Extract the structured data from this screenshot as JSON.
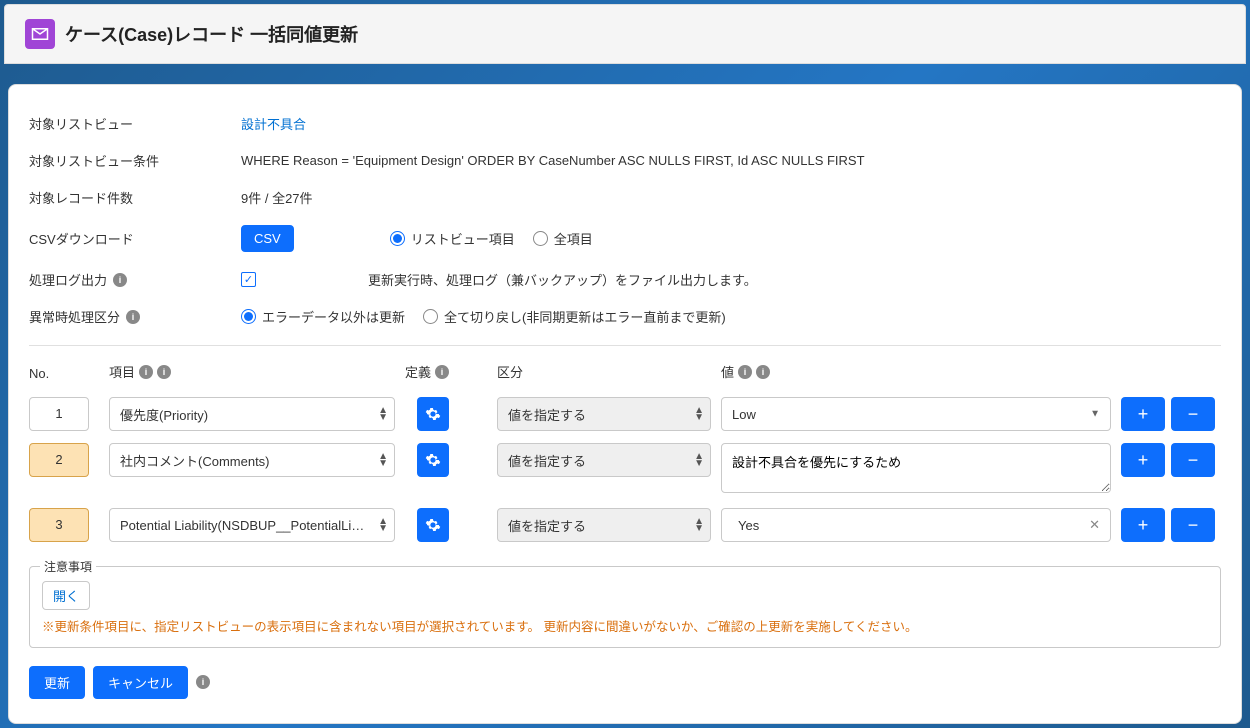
{
  "header": {
    "title": "ケース(Case)レコード 一括同値更新"
  },
  "info": {
    "listview_label": "対象リストビュー",
    "listview_value": "設計不具合",
    "condition_label": "対象リストビュー条件",
    "condition_value": "WHERE  Reason = 'Equipment Design'  ORDER BY  CaseNumber ASC NULLS FIRST, Id ASC NULLS FIRST",
    "count_label": "対象レコード件数",
    "count_value": "9件 / 全27件",
    "csv_label": "CSVダウンロード",
    "csv_button": "CSV",
    "csv_radio_a": "リストビュー項目",
    "csv_radio_b": "全項目",
    "log_label": "処理ログ出力",
    "log_desc": "更新実行時、処理ログ（兼バックアップ）をファイル出力します。",
    "err_label": "異常時処理区分",
    "err_radio_a": "エラーデータ以外は更新",
    "err_radio_b": "全て切り戻し(非同期更新はエラー直前まで更新)"
  },
  "grid": {
    "hdr_no": "No.",
    "hdr_field": "項目",
    "hdr_def": "定義",
    "hdr_type": "区分",
    "hdr_value": "値",
    "type_select_label": "値を指定する",
    "rows": [
      {
        "no": "1",
        "hl": false,
        "field": "優先度(Priority)",
        "value": "Low",
        "valuetype": "dd"
      },
      {
        "no": "2",
        "hl": true,
        "field": "社内コメント(Comments)",
        "value": "設計不具合を優先にするため",
        "valuetype": "ta"
      },
      {
        "no": "3",
        "hl": true,
        "field": "Potential Liability(NSDBUP__PotentialLiability_",
        "value": "Yes",
        "valuetype": "txt"
      }
    ]
  },
  "notice": {
    "legend": "注意事項",
    "open": "開く",
    "text": "※更新条件項目に、指定リストビューの表示項目に含まれない項目が選択されています。 更新内容に間違いがないか、ご確認の上更新を実施してください。"
  },
  "actions": {
    "update": "更新",
    "cancel": "キャンセル"
  }
}
